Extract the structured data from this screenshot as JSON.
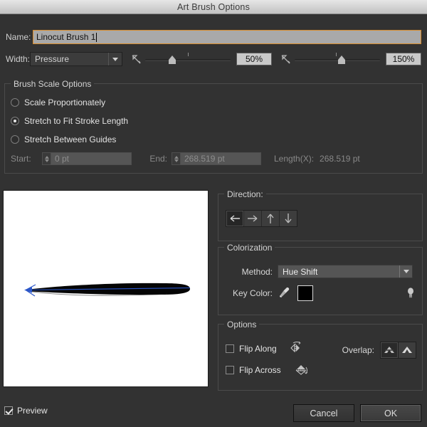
{
  "window": {
    "title": "Art Brush Options"
  },
  "name_row": {
    "label": "Name:",
    "value": "Linocut Brush 1"
  },
  "width_row": {
    "label": "Width:",
    "method": "Pressure",
    "min_icon": "pen-nib-icon",
    "min_value": "50%",
    "max_icon": "pen-nib-icon",
    "max_value": "150%"
  },
  "brush_scale": {
    "legend": "Brush Scale Options",
    "options": [
      {
        "label": "Scale Proportionately",
        "selected": false
      },
      {
        "label": "Stretch to Fit Stroke Length",
        "selected": true
      },
      {
        "label": "Stretch Between Guides",
        "selected": false
      }
    ],
    "start_label": "Start:",
    "start_value": "0 pt",
    "end_label": "End:",
    "end_value": "268.519 pt",
    "length_label": "Length(X):",
    "length_value": "268.519 pt"
  },
  "preview": {
    "name": "brush-stroke-preview"
  },
  "direction": {
    "legend": "Direction:",
    "buttons": [
      {
        "icon": "arrow-left-icon",
        "selected": true
      },
      {
        "icon": "arrow-right-icon",
        "selected": false
      },
      {
        "icon": "arrow-up-icon",
        "selected": false
      },
      {
        "icon": "arrow-down-icon",
        "selected": false
      }
    ]
  },
  "colorization": {
    "legend": "Colorization",
    "method_label": "Method:",
    "method_value": "Hue Shift",
    "key_color_label": "Key Color:",
    "eyedropper_icon": "eyedropper-icon",
    "key_color_swatch": "#000000",
    "tip_icon": "lightbulb-icon"
  },
  "options": {
    "legend": "Options",
    "flip_along_label": "Flip Along",
    "flip_along_checked": false,
    "flip_along_icon": "flip-along-icon",
    "flip_across_label": "Flip Across",
    "flip_across_checked": false,
    "flip_across_icon": "flip-across-icon",
    "overlap_label": "Overlap:",
    "overlap_buttons": [
      {
        "icon": "overlap-prevent-icon",
        "selected": true
      },
      {
        "icon": "overlap-allow-icon",
        "selected": false
      }
    ]
  },
  "footer": {
    "preview_label": "Preview",
    "preview_checked": true,
    "cancel_label": "Cancel",
    "ok_label": "OK"
  },
  "colors": {
    "dialog_bg": "#323232",
    "focus_accent": "#d88b2a",
    "field_light": "#a9a9a9",
    "text": "#c8c8c8",
    "stroke_black": "#000000",
    "path_blue": "#2b56c8"
  }
}
